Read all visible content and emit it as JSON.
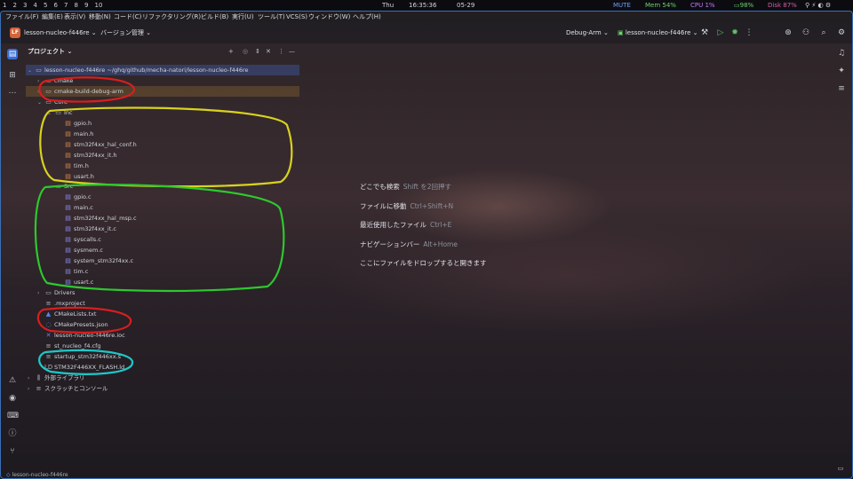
{
  "statusbar": {
    "workspaces": [
      "1",
      "2",
      "3",
      "4",
      "5",
      "6",
      "7",
      "8",
      "9",
      "10"
    ],
    "day": "Thu",
    "time": "16:35:36",
    "date": "05-29",
    "mute": "MUTE",
    "mem": "Mem 54%",
    "cpu": "CPU  1%",
    "battery": "98%",
    "disk": "Disk 87%"
  },
  "menubar": [
    "ファイル(F)",
    "編集(E)",
    "表示(V)",
    "移動(N)",
    "コード(C)",
    "リファクタリング(R)",
    "ビルド(B)",
    "実行(U)",
    "ツール(T)",
    "VCS(S)",
    "ウィンドウ(W)",
    "ヘルプ(H)"
  ],
  "toolbar": {
    "project_badge": "LF",
    "project_name": "lesson-nucleo-f446re",
    "vcs_label": "バージョン管理",
    "config": "Debug-Arm",
    "run_target": "lesson-nucleo-f446re"
  },
  "panel": {
    "title": "プロジェクト"
  },
  "tree": [
    {
      "label": "lesson-nucleo-f446re  ~/ghq/github/mecha-natori/lesson-nucleo-f446re",
      "indent": 0,
      "type": "folder",
      "open": true,
      "selected": true
    },
    {
      "label": "cmake",
      "indent": 1,
      "type": "folder",
      "open": false
    },
    {
      "label": "cmake-build-debug-arm",
      "indent": 1,
      "type": "folder",
      "open": false,
      "highlight": true
    },
    {
      "label": "Core",
      "indent": 1,
      "type": "folder",
      "open": true
    },
    {
      "label": "Inc",
      "indent": 2,
      "type": "folder",
      "open": true
    },
    {
      "label": "gpio.h",
      "indent": 3,
      "type": "h"
    },
    {
      "label": "main.h",
      "indent": 3,
      "type": "h"
    },
    {
      "label": "stm32f4xx_hal_conf.h",
      "indent": 3,
      "type": "h"
    },
    {
      "label": "stm32f4xx_it.h",
      "indent": 3,
      "type": "h"
    },
    {
      "label": "tim.h",
      "indent": 3,
      "type": "h"
    },
    {
      "label": "usart.h",
      "indent": 3,
      "type": "h"
    },
    {
      "label": "Src",
      "indent": 2,
      "type": "folder",
      "open": true
    },
    {
      "label": "gpio.c",
      "indent": 3,
      "type": "c"
    },
    {
      "label": "main.c",
      "indent": 3,
      "type": "c"
    },
    {
      "label": "stm32f4xx_hal_msp.c",
      "indent": 3,
      "type": "c"
    },
    {
      "label": "stm32f4xx_it.c",
      "indent": 3,
      "type": "c"
    },
    {
      "label": "syscalls.c",
      "indent": 3,
      "type": "c"
    },
    {
      "label": "sysmem.c",
      "indent": 3,
      "type": "c"
    },
    {
      "label": "system_stm32f4xx.c",
      "indent": 3,
      "type": "c"
    },
    {
      "label": "tim.c",
      "indent": 3,
      "type": "c"
    },
    {
      "label": "usart.c",
      "indent": 3,
      "type": "c"
    },
    {
      "label": "Drivers",
      "indent": 1,
      "type": "folder",
      "open": false
    },
    {
      "label": ".mxproject",
      "indent": 1,
      "type": "misc"
    },
    {
      "label": "CMakeLists.txt",
      "indent": 1,
      "type": "cmake"
    },
    {
      "label": "CMakePresets.json",
      "indent": 1,
      "type": "json"
    },
    {
      "label": "lesson-nucleo-f446re.ioc",
      "indent": 1,
      "type": "ioc"
    },
    {
      "label": "st_nucleo_f4.cfg",
      "indent": 1,
      "type": "misc"
    },
    {
      "label": "startup_stm32f446xx.s",
      "indent": 1,
      "type": "asm"
    },
    {
      "label": "STM32F446XX_FLASH.ld",
      "indent": 1,
      "type": "ld"
    },
    {
      "label": "外部ライブラリ",
      "indent": 0,
      "type": "lib",
      "open": false
    },
    {
      "label": "スクラッチとコンソール",
      "indent": 0,
      "type": "scratch",
      "open": false
    }
  ],
  "hints": [
    {
      "text": "どこでも検索",
      "shortcut": "Shift を2回押す"
    },
    {
      "text": "ファイルに移動",
      "shortcut": "Ctrl+Shift+N"
    },
    {
      "text": "最近使用したファイル",
      "shortcut": "Ctrl+E"
    },
    {
      "text": "ナビゲーションバー",
      "shortcut": "Alt+Home"
    },
    {
      "text": "ここにファイルをドロップすると開きます",
      "shortcut": ""
    }
  ],
  "bottombar": {
    "breadcrumb": "lesson-nucleo-f446re"
  }
}
